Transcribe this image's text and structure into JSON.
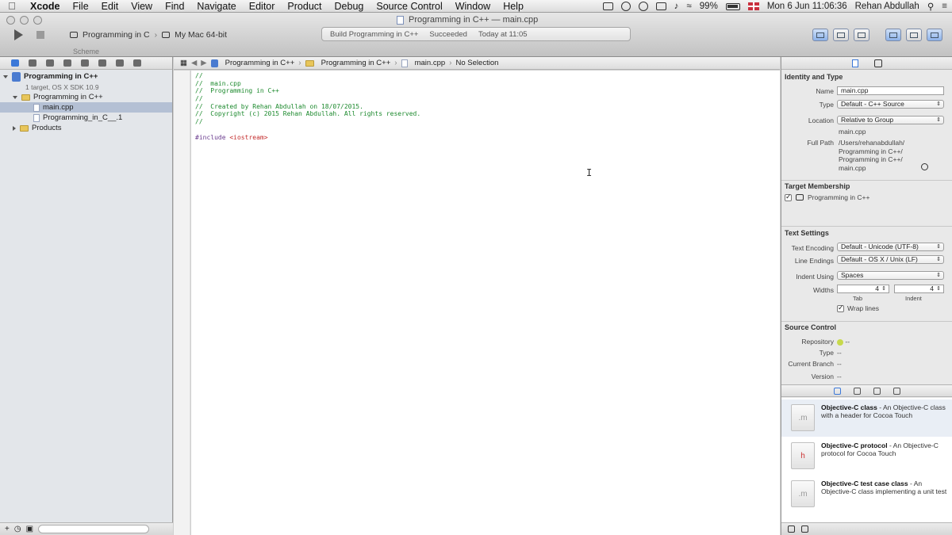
{
  "menubar": {
    "app": "Xcode",
    "items": [
      "File",
      "Edit",
      "View",
      "Find",
      "Navigate",
      "Editor",
      "Product",
      "Debug",
      "Source Control",
      "Window",
      "Help"
    ],
    "battery": "99%",
    "clock": "Mon 6 Jun  11:06:36",
    "user": "Rehan Abdullah"
  },
  "window": {
    "title": "Programming in C++ — main.cpp",
    "scheme": "Programming in C",
    "destination": "My Mac 64-bit",
    "activity": [
      "Build Programming in C++",
      "Succeeded",
      "Today at 11:05"
    ],
    "caption": "Scheme"
  },
  "navigator": {
    "project": {
      "name": "Programming in C++",
      "subtitle": "1 target, OS X SDK 10.9"
    },
    "group": "Programming in C++",
    "files": [
      "main.cpp",
      "Programming_in_C__.1"
    ],
    "products": "Products"
  },
  "jumpbar": {
    "crumbs": [
      "Programming in C++",
      "Programming in C++",
      "main.cpp",
      "No Selection"
    ]
  },
  "editor": {
    "lines": [
      {
        "t": "//",
        "k": "cmt"
      },
      {
        "t": "//  main.cpp",
        "k": "cmt"
      },
      {
        "t": "//  Programming in C++",
        "k": "cmt"
      },
      {
        "t": "//",
        "k": "cmt"
      },
      {
        "t": "//  Created by Rehan Abdullah on 18/07/2015.",
        "k": "cmt"
      },
      {
        "t": "//  Copyright (c) 2015 Rehan Abdullah. All rights reserved.",
        "k": "cmt"
      },
      {
        "t": "//",
        "k": "cmt"
      },
      {
        "t": "",
        "k": ""
      },
      {
        "t": "#include <iostream>",
        "k": "pp"
      }
    ],
    "cursor": "I"
  },
  "inspector": {
    "identity": {
      "title": "Identity and Type",
      "name_label": "Name",
      "name": "main.cpp",
      "type_label": "Type",
      "type": "Default - C++ Source",
      "location_label": "Location",
      "location": "Relative to Group",
      "location_file": "main.cpp",
      "fullpath_label": "Full Path",
      "fullpath": [
        "/Users/rehanabdullah/",
        "Programming in C++/",
        "Programming in C++/",
        "main.cpp"
      ]
    },
    "target": {
      "title": "Target Membership",
      "item": "Programming in C++"
    },
    "text": {
      "title": "Text Settings",
      "encoding_label": "Text Encoding",
      "encoding": "Default - Unicode (UTF-8)",
      "endings_label": "Line Endings",
      "endings": "Default - OS X / Unix (LF)",
      "indent_label": "Indent Using",
      "indent": "Spaces",
      "widths_label": "Widths",
      "tab_width": "4",
      "indent_width": "4",
      "tab_caption": "Tab",
      "indent_caption": "Indent",
      "wrap": "Wrap lines"
    },
    "source": {
      "title": "Source Control",
      "repo_label": "Repository",
      "repo": "--",
      "type_label": "Type",
      "type": "--",
      "branch_label": "Current Branch",
      "branch": "--",
      "version_label": "Version",
      "version": "--"
    },
    "library": [
      {
        "title": "Objective-C class",
        "desc": " - An Objective-C class with a header for Cocoa Touch"
      },
      {
        "title": "Objective-C protocol",
        "desc": " - An Objective-C protocol for Cocoa Touch"
      },
      {
        "title": "Objective-C test case class",
        "desc": " - An Objective-C class implementing a unit test"
      }
    ]
  }
}
